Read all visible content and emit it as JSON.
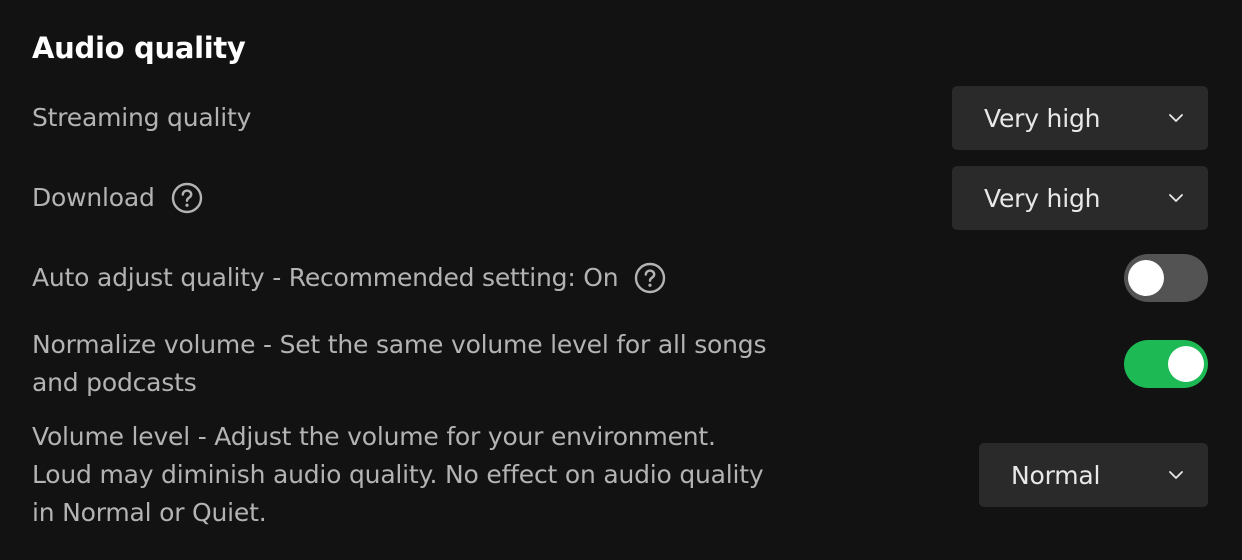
{
  "section": {
    "title": "Audio quality"
  },
  "settings": {
    "streaming_quality": {
      "label": "Streaming quality",
      "value": "Very high"
    },
    "download": {
      "label": "Download",
      "value": "Very high",
      "help_icon": "question-circle-icon"
    },
    "auto_adjust": {
      "label": "Auto adjust quality - Recommended setting: On",
      "enabled": false,
      "help_icon": "question-circle-icon"
    },
    "normalize_volume": {
      "label_line1": "Normalize volume - Set the same volume level for all songs",
      "label_line2": "and podcasts",
      "enabled": true
    },
    "volume_level": {
      "label_line1": "Volume level - Adjust the volume for your environment.",
      "label_line2": "Loud may diminish audio quality. No effect on audio quality",
      "label_line3": "in Normal or Quiet.",
      "value": "Normal"
    }
  },
  "colors": {
    "background": "#121212",
    "dropdown_bg": "#2a2a2a",
    "toggle_on": "#1db954",
    "toggle_off": "#535353",
    "label_text": "#b3b3b3",
    "heading_text": "#ffffff"
  },
  "icons": {
    "dropdown_chevron": "chevron-down-icon",
    "help": "question-circle-icon"
  }
}
